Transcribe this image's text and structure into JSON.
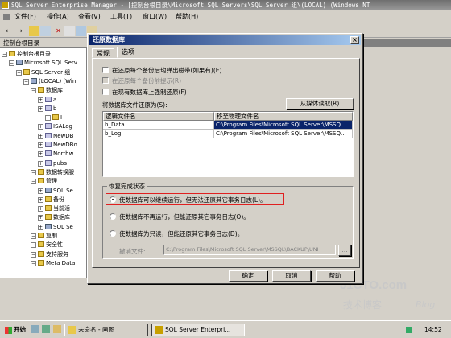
{
  "app": {
    "title": "SQL Server Enterprise Manager - [控制台根目录\\Microsoft SQL Servers\\SQL Server 组\\(LOCAL) (Windows NT"
  },
  "menu": [
    "文件(F)",
    "操作(A)",
    "查看(V)",
    "工具(T)",
    "窗口(W)",
    "帮助(H)"
  ],
  "tree": {
    "tab_label": "控制台根目录",
    "items": [
      {
        "label": "控制台根目录",
        "depth": 0
      },
      {
        "label": "Microsoft SQL Serv",
        "depth": 1
      },
      {
        "label": "SQL Server 组",
        "depth": 2
      },
      {
        "label": "(LOCAL) (Win",
        "depth": 3
      },
      {
        "label": "数据库",
        "depth": 4
      },
      {
        "label": "a",
        "depth": 5
      },
      {
        "label": "b",
        "depth": 5
      },
      {
        "label": "I",
        "depth": 6
      },
      {
        "label": "ISALog",
        "depth": 5
      },
      {
        "label": "NewDB",
        "depth": 5
      },
      {
        "label": "NewDBo",
        "depth": 5
      },
      {
        "label": "Northw",
        "depth": 5
      },
      {
        "label": "pubs",
        "depth": 5
      },
      {
        "label": "数据转换服",
        "depth": 4
      },
      {
        "label": "管理",
        "depth": 4
      },
      {
        "label": "SQL Se",
        "depth": 5
      },
      {
        "label": "备份",
        "depth": 5
      },
      {
        "label": "当前活",
        "depth": 5
      },
      {
        "label": "数据库",
        "depth": 5
      },
      {
        "label": "SQL Se",
        "depth": 5
      },
      {
        "label": "复制",
        "depth": 4
      },
      {
        "label": "安全性",
        "depth": 4
      },
      {
        "label": "支持服务",
        "depth": 4
      },
      {
        "label": "Meta Data",
        "depth": 4
      }
    ]
  },
  "dialog": {
    "title": "还原数据库",
    "close_glyph": "×",
    "tabs": [
      "常规",
      "选项"
    ],
    "options": [
      {
        "label": "在还原每个备份后均弹出磁带(如果有)(E)",
        "enabled": true
      },
      {
        "label": "在还原每个备份前提示(R)",
        "enabled": false
      },
      {
        "label": "在现有数据库上强制还原(F)",
        "enabled": true
      }
    ],
    "move_label": "将数据库文件还原为(S):",
    "from_media_button": "从媒体读取(R)",
    "grid": {
      "headers": [
        "逻辑文件名",
        "移至物理文件名"
      ],
      "rows": [
        [
          "b_Data",
          "C:\\Program Files\\Microsoft SQL Server\\MSSQ..."
        ],
        [
          "b_Log",
          "C:\\Program Files\\Microsoft SQL Server\\MSSQ..."
        ]
      ]
    },
    "recovery": {
      "group_label": "恢复完成状态",
      "options": [
        {
          "label": "使数据库可以继续运行，但无法还原其它事务日志(L)。",
          "selected": true
        },
        {
          "label": "使数据库不再运行，但能还原其它事务日志(O)。",
          "selected": false
        },
        {
          "label": "使数据库为只读，但能还原其它事务日志(D)。",
          "selected": false
        }
      ],
      "undo_label": "撤消文件:",
      "undo_value": "C:\\Program Files\\Microsoft SQL Server\\MSSQL\\BACKUP\\UNI",
      "browse_glyph": "..."
    },
    "buttons": {
      "ok": "确定",
      "cancel": "取消",
      "help": "帮助"
    }
  },
  "watermark": {
    "site": "51CTO.com",
    "tagline": "技术博客",
    "blog": "Blog"
  },
  "taskbar": {
    "start": "开始",
    "tasks": [
      {
        "label": "未命名 - 画图",
        "active": false
      },
      {
        "label": "SQL Server Enterpri...",
        "active": true
      }
    ],
    "clock": "14:52"
  },
  "colors": {
    "title_blue": "#0a246a",
    "highlight_red": "#e02020",
    "face": "#d4d0c8"
  }
}
